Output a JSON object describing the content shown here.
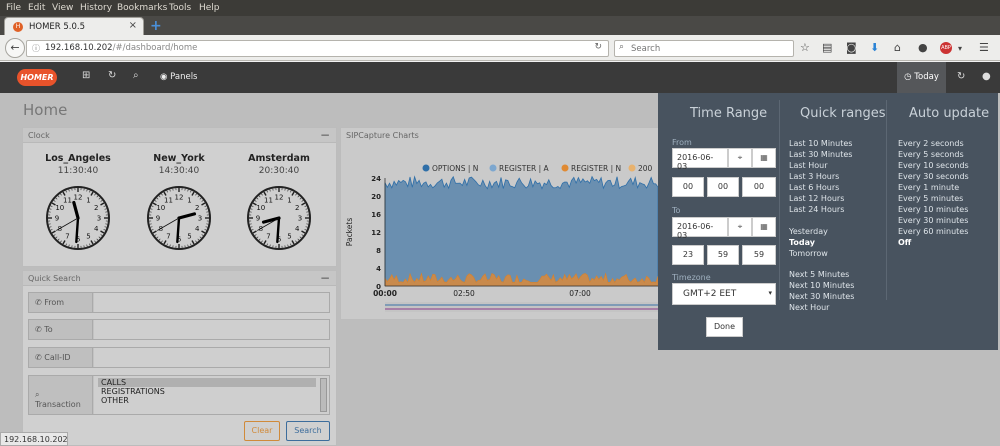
{
  "os_menu": [
    "File",
    "Edit",
    "View",
    "History",
    "Bookmarks",
    "Tools",
    "Help"
  ],
  "browser": {
    "tab_title": "HOMER 5.0.5",
    "tab_icon": "H",
    "url_host": "192.168.10.202",
    "url_path": "/#/dashboard/home",
    "search_placeholder": "Search",
    "status_url": "192.168.10.202"
  },
  "app": {
    "logo_text": "HOMER",
    "nav_panels": "Panels",
    "today_label": "Today",
    "page_title": "Home"
  },
  "clock_panel": {
    "title": "Clock",
    "clocks": [
      {
        "city": "Los_Angeles",
        "time": "11:30:40",
        "hour": 11,
        "minute": 30,
        "second": 40
      },
      {
        "city": "New_York",
        "time": "14:30:40",
        "hour": 14,
        "minute": 30,
        "second": 40
      },
      {
        "city": "Amsterdam",
        "time": "20:30:40",
        "hour": 20,
        "minute": 30,
        "second": 40
      }
    ]
  },
  "quick_search": {
    "title": "Quick Search",
    "from_label": "From",
    "to_label": "To",
    "callid_label": "Call-ID",
    "transaction_label": "Transaction",
    "transaction_options": [
      "CALLS",
      "REGISTRATIONS",
      "OTHER"
    ],
    "clear_label": "Clear",
    "search_label": "Search"
  },
  "chart_panel": {
    "title": "SIPCapture Charts"
  },
  "chart_data": {
    "type": "area",
    "title": "",
    "ylabel": "Packets",
    "xlabel": "",
    "x_ticks": [
      "00:00",
      "02:50",
      "07:00"
    ],
    "y_ticks": [
      0,
      4,
      8,
      12,
      16,
      20,
      24
    ],
    "ylim": [
      0,
      24
    ],
    "legend": [
      "OPTIONS | N",
      "REGISTER | A",
      "REGISTER | N",
      "200"
    ],
    "legend_colors": [
      "#2f6fa8",
      "#7da7cf",
      "#e08a33",
      "#e8b26e"
    ],
    "series": [
      {
        "name": "OPTIONS | N",
        "approx_level": 23,
        "approx_range": [
          21,
          24.5
        ]
      },
      {
        "name": "REGISTER | N",
        "approx_level": 1.6,
        "approx_range": [
          0.8,
          3
        ]
      }
    ]
  },
  "time_range": {
    "heading": "Time Range",
    "from_label": "From",
    "from_date": "2016-06-03",
    "from_h": "00",
    "from_m": "00",
    "from_s": "00",
    "to_label": "To",
    "to_date": "2016-06-03",
    "to_h": "23",
    "to_m": "59",
    "to_s": "59",
    "timezone_label": "Timezone",
    "timezone_value": "GMT+2 EET",
    "done_label": "Done"
  },
  "quick_ranges": {
    "heading": "Quick ranges",
    "group1": [
      "Last 10 Minutes",
      "Last 30 Minutes",
      "Last Hour",
      "Last 3 Hours",
      "Last 6 Hours",
      "Last 12 Hours",
      "Last 24 Hours"
    ],
    "group2": [
      "Yesterday",
      "Today",
      "Tomorrow"
    ],
    "group3": [
      "Next 5 Minutes",
      "Next 10 Minutes",
      "Next 30 Minutes",
      "Next Hour"
    ],
    "selected": "Today"
  },
  "auto_update": {
    "heading": "Auto update",
    "options": [
      "Every 2 seconds",
      "Every 5 seconds",
      "Every 10 seconds",
      "Every 30 seconds",
      "Every 1 minute",
      "Every 5 minutes",
      "Every 10 minutes",
      "Every 30 minutes",
      "Every 60 minutes",
      "Off"
    ],
    "selected": "Off"
  },
  "colors": {
    "appbar": "#3a3a3a",
    "logo": "#e8532b",
    "dropdown": "#48535f"
  }
}
